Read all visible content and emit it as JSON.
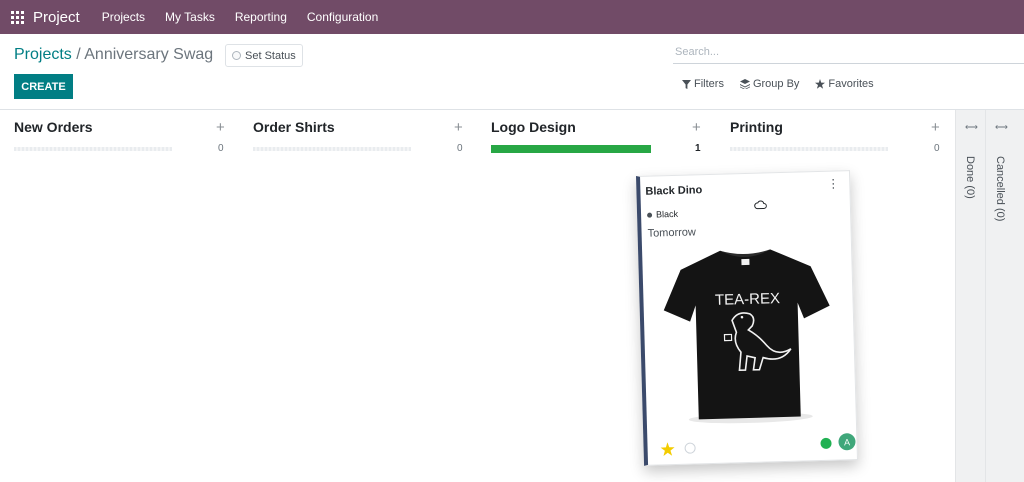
{
  "navbar": {
    "brand": "Project",
    "menu": [
      "Projects",
      "My Tasks",
      "Reporting",
      "Configuration"
    ]
  },
  "breadcrumb": {
    "parent": "Projects",
    "separator": " / ",
    "current": "Anniversary Swag"
  },
  "set_status_label": "Set Status",
  "create_label": "CREATE",
  "search": {
    "placeholder": "Search..."
  },
  "filters": {
    "filters_label": "Filters",
    "group_by_label": "Group By",
    "favorites_label": "Favorites"
  },
  "columns": [
    {
      "title": "New Orders",
      "count": "0",
      "progress": 0
    },
    {
      "title": "Order Shirts",
      "count": "0",
      "progress": 0
    },
    {
      "title": "Logo Design",
      "count": "1",
      "progress": 1
    },
    {
      "title": "Printing",
      "count": "0",
      "progress": 0
    }
  ],
  "folded_columns": [
    {
      "title": "Done (0)"
    },
    {
      "title": "Cancelled (0)"
    }
  ],
  "card": {
    "title": "Black Dino",
    "tag": "Black",
    "deadline": "Tomorrow",
    "image_text": "TEA-REX",
    "avatar_initial": "A",
    "starred": true
  },
  "colors": {
    "navbar": "#714b67",
    "primary": "#017e84",
    "progress_green": "#28a745",
    "star": "#f3cc00"
  }
}
